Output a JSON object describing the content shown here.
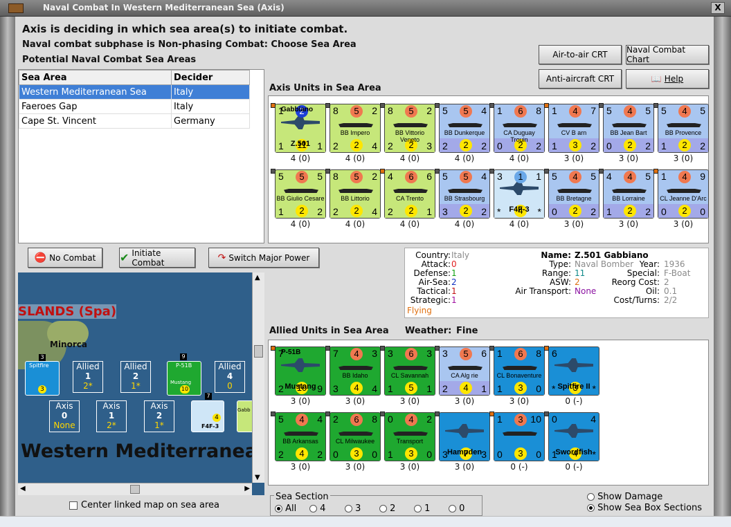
{
  "window": {
    "title": "Naval Combat In Western Mediterranean Sea (Axis)",
    "close": "X"
  },
  "header": {
    "line1": "Axis is deciding in which sea area(s) to initiate combat.",
    "line2": "Naval combat subphase is Non-phasing Combat: Choose Sea Area",
    "line3": "Potential Naval Combat Sea Areas"
  },
  "sea_table": {
    "columns": [
      "Sea Area",
      "Decider"
    ],
    "rows": [
      {
        "area": "Western Mediterranean Sea",
        "decider": "Italy"
      },
      {
        "area": "Faeroes Gap",
        "decider": "Italy"
      },
      {
        "area": "Cape St. Vincent",
        "decider": "Germany"
      }
    ]
  },
  "buttons": {
    "air_crt": "Air-to-air CRT",
    "naval_chart": "Naval Combat Chart",
    "aa_crt": "Anti-aircraft CRT",
    "help": "Help",
    "no_combat": "No Combat",
    "initiate": "Initiate Combat",
    "switch": "Switch Major Power"
  },
  "axis_title": "Axis Units in Sea Area",
  "allied_title": "Allied Units in Sea Area",
  "weather_label": "Weather:",
  "weather": "Fine",
  "axis_units": [
    {
      "name": "Z.501",
      "top": "Gabbiano",
      "tl": "1",
      "tm": "2",
      "tr": "",
      "bl": "1",
      "bm": "11",
      "br": "1",
      "label": "4 (0)",
      "color": "#c6e77a",
      "band": "#c6e77a",
      "circ": "#1d3fd6",
      "kind": "plane"
    },
    {
      "name": "BB Impero",
      "tl": "8",
      "tm": "5",
      "tr": "2",
      "bl": "2",
      "bm": "2",
      "br": "4",
      "label": "4 (0)",
      "color": "#c6e77a",
      "band": "#c6e77a",
      "circ": "#f07850",
      "kind": "ship"
    },
    {
      "name": "BB Vittorio Veneto",
      "tl": "8",
      "tm": "5",
      "tr": "2",
      "bl": "2",
      "bm": "2",
      "br": "3",
      "label": "4 (0)",
      "color": "#c6e77a",
      "band": "#c6e77a",
      "circ": "#f07850",
      "kind": "ship"
    },
    {
      "name": "BB Dunkerque",
      "tl": "5",
      "tm": "5",
      "tr": "4",
      "bl": "2",
      "bm": "2",
      "br": "2",
      "label": "4 (0)",
      "color": "#a9c6f0",
      "band": "#a3a9e8",
      "circ": "#f07850",
      "kind": "ship"
    },
    {
      "name": "CA Duguay Trouin",
      "tl": "1",
      "tm": "6",
      "tr": "8",
      "bl": "0",
      "bm": "2",
      "br": "2",
      "label": "4 (0)",
      "color": "#a9c6f0",
      "band": "#a3a9e8",
      "circ": "#f07850",
      "kind": "ship"
    },
    {
      "name": "CV B arn",
      "tl": "1",
      "tm": "4",
      "tr": "7",
      "bl": "1",
      "bm": "3",
      "br": "2",
      "label": "3 (0)",
      "color": "#a9c6f0",
      "band": "#a3a9e8",
      "circ": "#f07850",
      "kind": "ship"
    },
    {
      "name": "BB Jean Bart",
      "tl": "5",
      "tm": "4",
      "tr": "5",
      "bl": "0",
      "bm": "2",
      "br": "2",
      "label": "3 (0)",
      "color": "#a9c6f0",
      "band": "#a3a9e8",
      "circ": "#f07850",
      "kind": "ship"
    },
    {
      "name": "BB Provence",
      "tl": "5",
      "tm": "4",
      "tr": "5",
      "bl": "1",
      "bm": "2",
      "br": "2",
      "label": "3 (0)",
      "color": "#a9c6f0",
      "band": "#a3a9e8",
      "circ": "#f07850",
      "kind": "ship"
    },
    {
      "name": "BB Giulio Cesare",
      "tl": "5",
      "tm": "5",
      "tr": "5",
      "bl": "1",
      "bm": "2",
      "br": "2",
      "label": "4 (0)",
      "color": "#c6e77a",
      "band": "#c6e77a",
      "circ": "#f07850",
      "kind": "ship"
    },
    {
      "name": "BB Littorio",
      "tl": "8",
      "tm": "5",
      "tr": "2",
      "bl": "2",
      "bm": "2",
      "br": "4",
      "label": "4 (0)",
      "color": "#c6e77a",
      "band": "#c6e77a",
      "circ": "#f07850",
      "kind": "ship"
    },
    {
      "name": "CA Trento",
      "tl": "4",
      "tm": "6",
      "tr": "6",
      "bl": "2",
      "bm": "2",
      "br": "1",
      "label": "4 (0)",
      "color": "#c6e77a",
      "band": "#c6e77a",
      "circ": "#f07850",
      "kind": "ship"
    },
    {
      "name": "BB Strasbourg",
      "tl": "5",
      "tm": "5",
      "tr": "4",
      "bl": "3",
      "bm": "2",
      "br": "2",
      "label": "4 (0)",
      "color": "#a9c6f0",
      "band": "#a3a9e8",
      "circ": "#f07850",
      "kind": "ship"
    },
    {
      "name": "F4F-3",
      "tl": "3",
      "tm": "1",
      "tr": "1",
      "bl": "*",
      "bm": "4",
      "br": "*",
      "label": "4 (0)",
      "color": "#cfe6f7",
      "band": "#cfe6f7",
      "circ": "#6aa8e8",
      "kind": "plane"
    },
    {
      "name": "BB Bretagne",
      "tl": "5",
      "tm": "4",
      "tr": "5",
      "bl": "0",
      "bm": "2",
      "br": "2",
      "label": "3 (0)",
      "color": "#a9c6f0",
      "band": "#a3a9e8",
      "circ": "#f07850",
      "kind": "ship"
    },
    {
      "name": "BB Lorraine",
      "tl": "4",
      "tm": "4",
      "tr": "5",
      "bl": "1",
      "bm": "2",
      "br": "2",
      "label": "3 (0)",
      "color": "#a9c6f0",
      "band": "#a3a9e8",
      "circ": "#f07850",
      "kind": "ship"
    },
    {
      "name": "CL Jeanne D'Arc",
      "tl": "1",
      "tm": "4",
      "tr": "9",
      "bl": "0",
      "bm": "2",
      "br": "0",
      "label": "3 (0)",
      "color": "#a9c6f0",
      "band": "#a3a9e8",
      "circ": "#f07850",
      "kind": "ship"
    }
  ],
  "allied_units": [
    {
      "name": "Mustang",
      "top": "P-51B",
      "tl": "7",
      "tm": "",
      "tr": "",
      "bl": "2",
      "bm": "10",
      "br": "9",
      "label": "3 (0)",
      "color": "#1fa830",
      "band": "#1fa830",
      "circ": "#f07850",
      "kind": "plane"
    },
    {
      "name": "BB Idaho",
      "tl": "7",
      "tm": "4",
      "tr": "3",
      "bl": "3",
      "bm": "4",
      "br": "4",
      "label": "3 (0)",
      "color": "#1fa830",
      "band": "#1fa830",
      "circ": "#f07850",
      "kind": "ship"
    },
    {
      "name": "CL Savannah",
      "tl": "3",
      "tm": "6",
      "tr": "3",
      "bl": "1",
      "bm": "5",
      "br": "1",
      "label": "3 (0)",
      "color": "#1fa830",
      "band": "#1fa830",
      "circ": "#f07850",
      "kind": "ship"
    },
    {
      "name": "CA Alg rie",
      "tl": "3",
      "tm": "5",
      "tr": "6",
      "bl": "2",
      "bm": "4",
      "br": "1",
      "label": "3 (0)",
      "color": "#a9c6f0",
      "band": "#a3a9e8",
      "circ": "#f07850",
      "kind": "ship"
    },
    {
      "name": "CL Bonaventure",
      "tl": "1",
      "tm": "6",
      "tr": "8",
      "bl": "1",
      "bm": "3",
      "br": "0",
      "label": "3 (0)",
      "color": "#1a8fd6",
      "band": "#1a8fd6",
      "circ": "#f07850",
      "kind": "ship"
    },
    {
      "name": "Spitfire II",
      "tl": "6",
      "tm": "",
      "tr": "",
      "bl": "*",
      "bm": "3",
      "br": "*",
      "label": "0 (-)",
      "color": "#1a8fd6",
      "band": "#1a8fd6",
      "circ": "#f07850",
      "kind": "plane"
    },
    {
      "name": "BB Arkansas",
      "tl": "5",
      "tm": "4",
      "tr": "4",
      "bl": "2",
      "bm": "4",
      "br": "2",
      "label": "3 (0)",
      "color": "#1fa830",
      "band": "#1fa830",
      "circ": "#f07850",
      "kind": "ship"
    },
    {
      "name": "CL Milwaukee",
      "tl": "2",
      "tm": "6",
      "tr": "8",
      "bl": "0",
      "bm": "3",
      "br": "0",
      "label": "3 (0)",
      "color": "#1fa830",
      "band": "#1fa830",
      "circ": "#f07850",
      "kind": "ship"
    },
    {
      "name": "Transport",
      "tl": "0",
      "tm": "4",
      "tr": "2",
      "bl": "1",
      "bm": "3",
      "br": "0",
      "label": "3 (0)",
      "color": "#1fa830",
      "band": "#1fa830",
      "circ": "#f07850",
      "kind": "ship"
    },
    {
      "name": "Hampden",
      "tl": "",
      "tm": "",
      "tr": "",
      "bl": "3",
      "bm": "7",
      "br": "3",
      "label": "3 (0)",
      "color": "#1a8fd6",
      "band": "#1a8fd6",
      "circ": "#f07850",
      "kind": "plane"
    },
    {
      "name": "",
      "tl": "1",
      "tm": "3",
      "tr": "10",
      "bl": "0",
      "bm": "3",
      "br": "0",
      "label": "0 (-)",
      "color": "#1a8fd6",
      "band": "#1a8fd6",
      "circ": "#f07850",
      "kind": "ship"
    },
    {
      "name": "Swordfish",
      "tl": "0",
      "tm": "",
      "tr": "4",
      "bl": "1",
      "bm": "4",
      "br": "*",
      "label": "0 (-)",
      "color": "#1a8fd6",
      "band": "#1a8fd6",
      "circ": "#f07850",
      "kind": "plane"
    }
  ],
  "info": {
    "country_l": "Country:",
    "country": "Italy",
    "attack_l": "Attack:",
    "attack": "0",
    "defense_l": "Defense:",
    "defense": "1",
    "airsea_l": "Air-Sea:",
    "airsea": "2",
    "tactical_l": "Tactical:",
    "tactical": "1",
    "strategic_l": "Strategic:",
    "strategic": "1",
    "flying": "Flying",
    "name_l": "Name:",
    "name": "Z.501 Gabbiano",
    "type_l": "Type:",
    "type": "Naval Bomber",
    "year_l": "Year:",
    "year": "1936",
    "range_l": "Range:",
    "range": "11",
    "special_l": "Special:",
    "special": "F-Boat",
    "asw_l": "ASW:",
    "asw": "2",
    "reorg_l": "Reorg Cost:",
    "reorg": "2",
    "oil_l": "Oil:",
    "oil": "0.1",
    "airtr_l": "Air Transport:",
    "airtr": "None",
    "cost_l": "Cost/Turns:",
    "cost": "2/2"
  },
  "map": {
    "region": "SLANDS (Spa)",
    "island": "Minorca",
    "sea": "Western Mediterranea",
    "allied_boxes": [
      {
        "t": "Allied",
        "n": "1",
        "s": "2*"
      },
      {
        "t": "Allied",
        "n": "2",
        "s": "1*"
      },
      {
        "t": "Allied",
        "n": "4",
        "s": "0"
      }
    ],
    "axis_boxes": [
      {
        "t": "Axis",
        "n": "0",
        "s": "None"
      },
      {
        "t": "Axis",
        "n": "1",
        "s": "2*"
      },
      {
        "t": "Axis",
        "n": "2",
        "s": "1*"
      }
    ],
    "counters": {
      "spit": "Spitfire",
      "spit_n": "3",
      "p51": "P-51B",
      "p51_s": "Mustang",
      "p51_n": "9",
      "p51_v": "10",
      "f4f": "F4F-3",
      "f4f_n": "7",
      "f4f_v": "4",
      "gab": "Gabb"
    }
  },
  "center_map": "Center linked map on sea area",
  "sea_section": {
    "title": "Sea Section",
    "options": [
      "All",
      "4",
      "3",
      "2",
      "1",
      "0"
    ],
    "selected": "All"
  },
  "show_damage": "Show Damage",
  "show_boxes": "Show Sea Box Sections"
}
